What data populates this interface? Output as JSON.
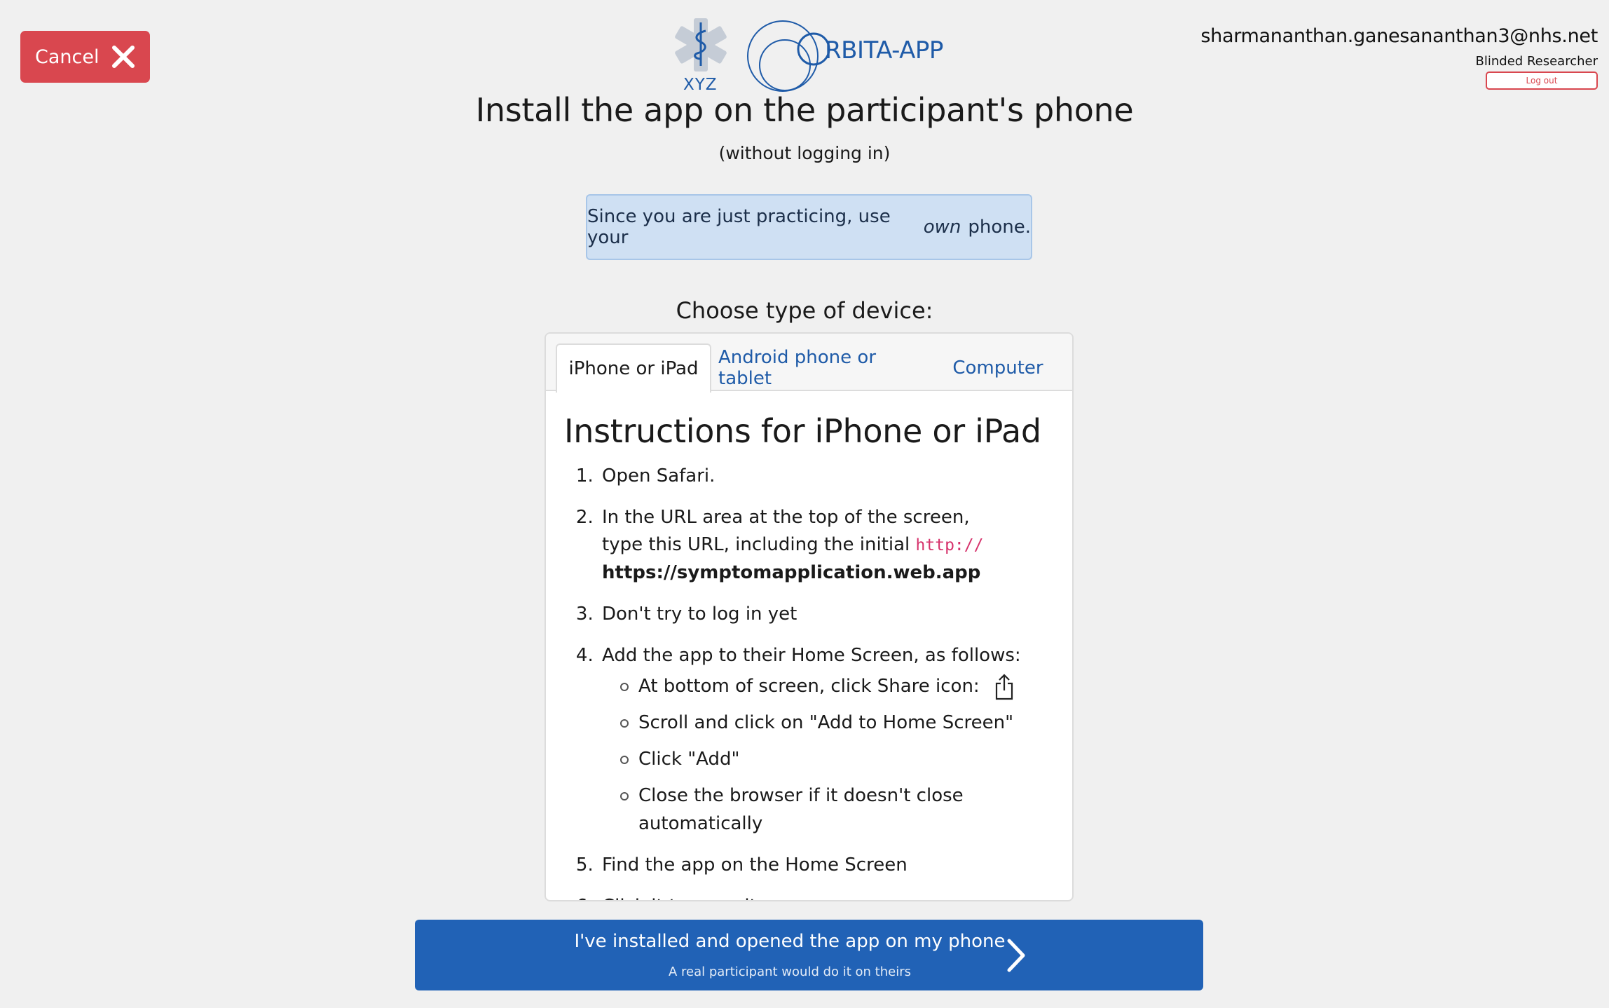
{
  "header": {
    "cancel_label": "Cancel",
    "logo_text": "XYZ",
    "app_name": "RBITA-APP",
    "user_email": "sharmananthan.ganesananthan3@nhs.net",
    "user_role": "Blinded Researcher",
    "logout_label": "Log out"
  },
  "page": {
    "title": "Install the app on the participant's phone",
    "subtitle": "(without logging in)"
  },
  "alert": {
    "text_before": "Since you are just practicing, use your",
    "emphasis": "own",
    "text_after": "phone."
  },
  "device_chooser": {
    "label": "Choose type of device:",
    "tabs": [
      {
        "label": "iPhone or iPad",
        "active": true
      },
      {
        "label": "Android phone or tablet",
        "active": false
      },
      {
        "label": "Computer",
        "active": false
      }
    ]
  },
  "instructions": {
    "title": "Instructions for iPhone or iPad",
    "step1": "Open Safari.",
    "step2_line1": "In the URL area at the top of the screen,",
    "step2_line2": "type this URL, including the initial",
    "step2_code": "http://",
    "step2_url": "https://symptomapplication.web.app",
    "step3": "Don't try to log in yet",
    "step4": "Add the app to their Home Screen, as follows:",
    "substeps": [
      "At bottom of screen, click Share icon:",
      "Scroll and click on \"Add to Home Screen\"",
      "Click \"Add\"",
      "Close the browser if it doesn't close automatically"
    ],
    "step5": "Find the app on the Home Screen",
    "step6": "Click it to open it"
  },
  "footer_button": {
    "main_label": "I've installed and opened the app on my phone",
    "sub_label": "A real participant would do it on theirs"
  },
  "colors": {
    "cancel": "#d9474f",
    "primary": "#2162b6",
    "link": "#1f5ba8",
    "alert_bg": "#cfe0f3",
    "code": "#d6336c"
  }
}
